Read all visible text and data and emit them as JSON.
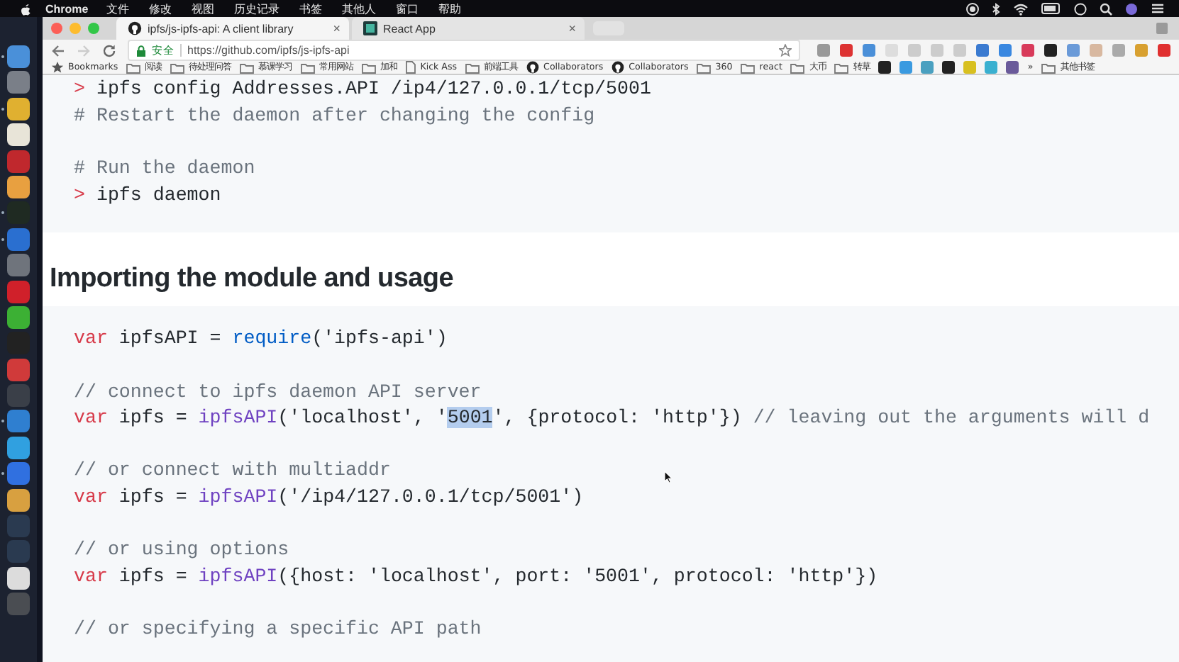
{
  "menu_bar": {
    "app": "Chrome",
    "menus": [
      "文件",
      "修改",
      "视图",
      "历史记录",
      "书签",
      "其他人",
      "窗口",
      "帮助"
    ]
  },
  "dock": {
    "apps": [
      {
        "color": "#4a90d9",
        "running": true
      },
      {
        "color": "#7a7f88",
        "running": false
      },
      {
        "color": "#e0b030",
        "running": true
      },
      {
        "color": "#e8e4d8",
        "running": false
      },
      {
        "color": "#c0282d",
        "running": false
      },
      {
        "color": "#e8a040",
        "running": false
      },
      {
        "color": "#1f2a22",
        "running": true
      },
      {
        "color": "#2a6fd0",
        "running": true
      },
      {
        "color": "#6f747c",
        "running": false
      },
      {
        "color": "#d0202a",
        "running": false
      },
      {
        "color": "#3cb034",
        "running": false
      },
      {
        "color": "#222222",
        "running": false
      },
      {
        "color": "#d03a3a",
        "running": false
      },
      {
        "color": "#3a3f48",
        "running": false
      },
      {
        "color": "#2f7fd0",
        "running": true
      },
      {
        "color": "#30a0e0",
        "running": false
      },
      {
        "color": "#3070e0",
        "running": true
      },
      {
        "color": "#d8a040",
        "running": false
      },
      {
        "color": "#2a3a50",
        "running": false
      },
      {
        "color": "#2a3a50",
        "running": false
      },
      {
        "color": "#dcdcdc",
        "running": false
      },
      {
        "color": "#4a4d52",
        "running": false
      }
    ]
  },
  "tabs": [
    {
      "title": "ipfs/js-ipfs-api: A client library",
      "close": "×",
      "selected": true
    },
    {
      "title": "React App",
      "close": "×",
      "selected": false
    }
  ],
  "address_bar": {
    "security": "安全",
    "url": "https://github.com/ipfs/js-ipfs-api"
  },
  "bookmarks": [
    {
      "kind": "star",
      "label": "Bookmarks"
    },
    {
      "kind": "folder",
      "label": "阅读"
    },
    {
      "kind": "folder",
      "label": "待处理问答"
    },
    {
      "kind": "folder",
      "label": "慕课学习"
    },
    {
      "kind": "folder",
      "label": "常用网站"
    },
    {
      "kind": "folder",
      "label": "加和"
    },
    {
      "kind": "page",
      "label": "Kick Ass"
    },
    {
      "kind": "folder",
      "label": "前端工具"
    },
    {
      "kind": "github",
      "label": "Collaborators"
    },
    {
      "kind": "github",
      "label": "Collaborators"
    },
    {
      "kind": "folder",
      "label": "360"
    },
    {
      "kind": "folder",
      "label": "react"
    },
    {
      "kind": "folder",
      "label": "大币"
    },
    {
      "kind": "folder",
      "label": "转草"
    },
    {
      "kind": "more",
      "label": "»"
    },
    {
      "kind": "folder",
      "label": "其他书签"
    }
  ],
  "shell_block": {
    "groups": [
      [
        [
          {
            "kind": "prompt",
            "text": ">"
          },
          {
            "kind": "plain",
            "text": " ipfs config Addresses.API /ip4/127.0.0.1/tcp/5001"
          }
        ],
        [
          {
            "kind": "comment",
            "text": "# Restart the daemon after changing the config"
          }
        ]
      ],
      [
        [
          {
            "kind": "comment",
            "text": "# Run the daemon"
          }
        ],
        [
          {
            "kind": "prompt",
            "text": ">"
          },
          {
            "kind": "plain",
            "text": " ipfs daemon"
          }
        ]
      ]
    ]
  },
  "heading": "Importing the module and usage",
  "code_block": {
    "groups": [
      [
        [
          {
            "kind": "keyword",
            "text": "var"
          },
          {
            "kind": "plain",
            "text": " ipfsAPI = "
          },
          {
            "kind": "builtin",
            "text": "require"
          },
          {
            "kind": "plain",
            "text": "('ipfs-api')"
          }
        ]
      ],
      [
        [
          {
            "kind": "comment",
            "text": "// connect to ipfs daemon API server"
          }
        ],
        [
          {
            "kind": "keyword",
            "text": "var"
          },
          {
            "kind": "plain",
            "text": " ipfs = "
          },
          {
            "kind": "function",
            "text": "ipfsAPI"
          },
          {
            "kind": "plain",
            "text": "('localhost', '"
          },
          {
            "kind": "selection",
            "text": "5001"
          },
          {
            "kind": "plain",
            "text": "', {protocol: 'http'}) "
          },
          {
            "kind": "comment",
            "text": "// leaving out the arguments will d"
          }
        ]
      ],
      [
        [
          {
            "kind": "comment",
            "text": "// or connect with multiaddr"
          }
        ],
        [
          {
            "kind": "keyword",
            "text": "var"
          },
          {
            "kind": "plain",
            "text": " ipfs = "
          },
          {
            "kind": "function",
            "text": "ipfsAPI"
          },
          {
            "kind": "plain",
            "text": "('/ip4/127.0.0.1/tcp/5001')"
          }
        ]
      ],
      [
        [
          {
            "kind": "comment",
            "text": "// or using options"
          }
        ],
        [
          {
            "kind": "keyword",
            "text": "var"
          },
          {
            "kind": "plain",
            "text": " ipfs = "
          },
          {
            "kind": "function",
            "text": "ipfsAPI"
          },
          {
            "kind": "plain",
            "text": "({host: 'localhost', port: '5001', protocol: 'http'})"
          }
        ]
      ],
      [
        [
          {
            "kind": "comment",
            "text": "// or specifying a specific API path"
          }
        ]
      ]
    ]
  }
}
